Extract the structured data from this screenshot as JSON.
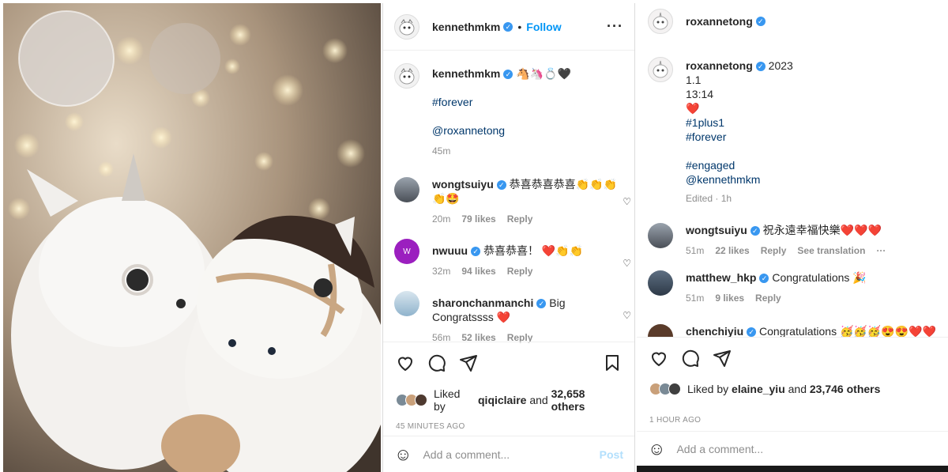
{
  "left_post": {
    "username": "kennethmkm",
    "follow_label": "Follow",
    "caption": {
      "username": "kennethmkm",
      "emoji": "🐴🦄💍🖤",
      "tag": "#forever",
      "mention": "@roxannetong",
      "time": "45m"
    },
    "comments": [
      {
        "username": "wongtsuiyu",
        "text": "恭喜恭喜恭喜👏👏👏👏🤩",
        "time": "20m",
        "likes": "79 likes",
        "reply": "Reply"
      },
      {
        "username": "nwuuu",
        "text": "恭喜恭喜！ ❤️👏👏",
        "time": "32m",
        "likes": "94 likes",
        "reply": "Reply"
      },
      {
        "username": "sharonchanmanchi",
        "text": "Big Congratssss ❤️",
        "time": "56m",
        "likes": "52 likes",
        "reply": "Reply"
      }
    ],
    "liked_prefix": "Liked by",
    "liked_user": "qiqiclaire",
    "liked_and": "and",
    "liked_others": "32,658 others",
    "ago": "45 MINUTES AGO",
    "add_comment": "Add a comment...",
    "post_label": "Post"
  },
  "right_post": {
    "username": "roxannetong",
    "caption": {
      "username": "roxannetong",
      "lines": [
        "2023",
        "1.1",
        "13:14",
        "❤️"
      ],
      "tags": [
        "#1plus1",
        "#forever",
        "#engaged"
      ],
      "mention": "@kennethmkm",
      "edited": "Edited · 1h"
    },
    "comments": [
      {
        "username": "wongtsuiyu",
        "text": "祝永遠幸福快樂❤️❤️❤️",
        "time": "51m",
        "likes": "22 likes",
        "reply": "Reply",
        "translate": "See translation"
      },
      {
        "username": "matthew_hkp",
        "text": "Congratulations 🎉",
        "time": "51m",
        "likes": "9 likes",
        "reply": "Reply"
      },
      {
        "username": "chenchiyiu",
        "text": "Congratulations 🥳🥳🥳😍😍❤️❤️"
      }
    ],
    "liked_prefix": "Liked by",
    "liked_user": "elaine_yiu",
    "liked_and": "and",
    "liked_others": "23,746 others",
    "ago": "1 HOUR AGO",
    "add_comment": "Add a comment..."
  }
}
